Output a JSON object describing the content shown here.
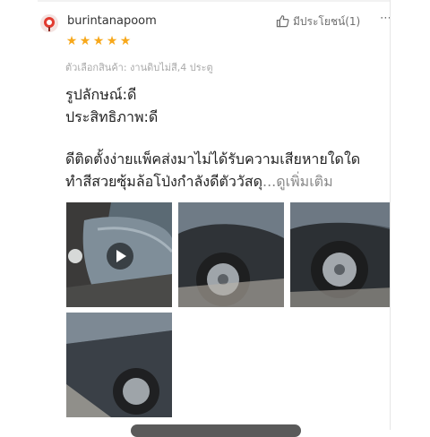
{
  "review": {
    "username": "burintanapoom",
    "rating": 5,
    "like_label": "มีประโยชน์(1)",
    "more_label": "⋯",
    "variation": "ตัวเลือกสินค้า: งานดิบไม่สี,4 ประตู",
    "attributes": [
      "รูปลักษณ์:ดี",
      "ประสิทธิภาพ:ดี"
    ],
    "body_line_1": "ดีติดตั้งง่ายแพ็คส่งมาไม่ได้รับความเสียหายใดใด",
    "body_line_2": "ทำสีสวยซุ้มล้อโป่งกำลังดีตัววัสดุ",
    "see_more": "...ดูเพิ่มเติม",
    "media": [
      {
        "kind": "video",
        "icon": "play-icon"
      },
      {
        "kind": "image"
      },
      {
        "kind": "image"
      },
      {
        "kind": "image"
      }
    ]
  },
  "colors": {
    "star": "#f7a81b",
    "text": "#222222",
    "muted": "#a9a9a9"
  }
}
